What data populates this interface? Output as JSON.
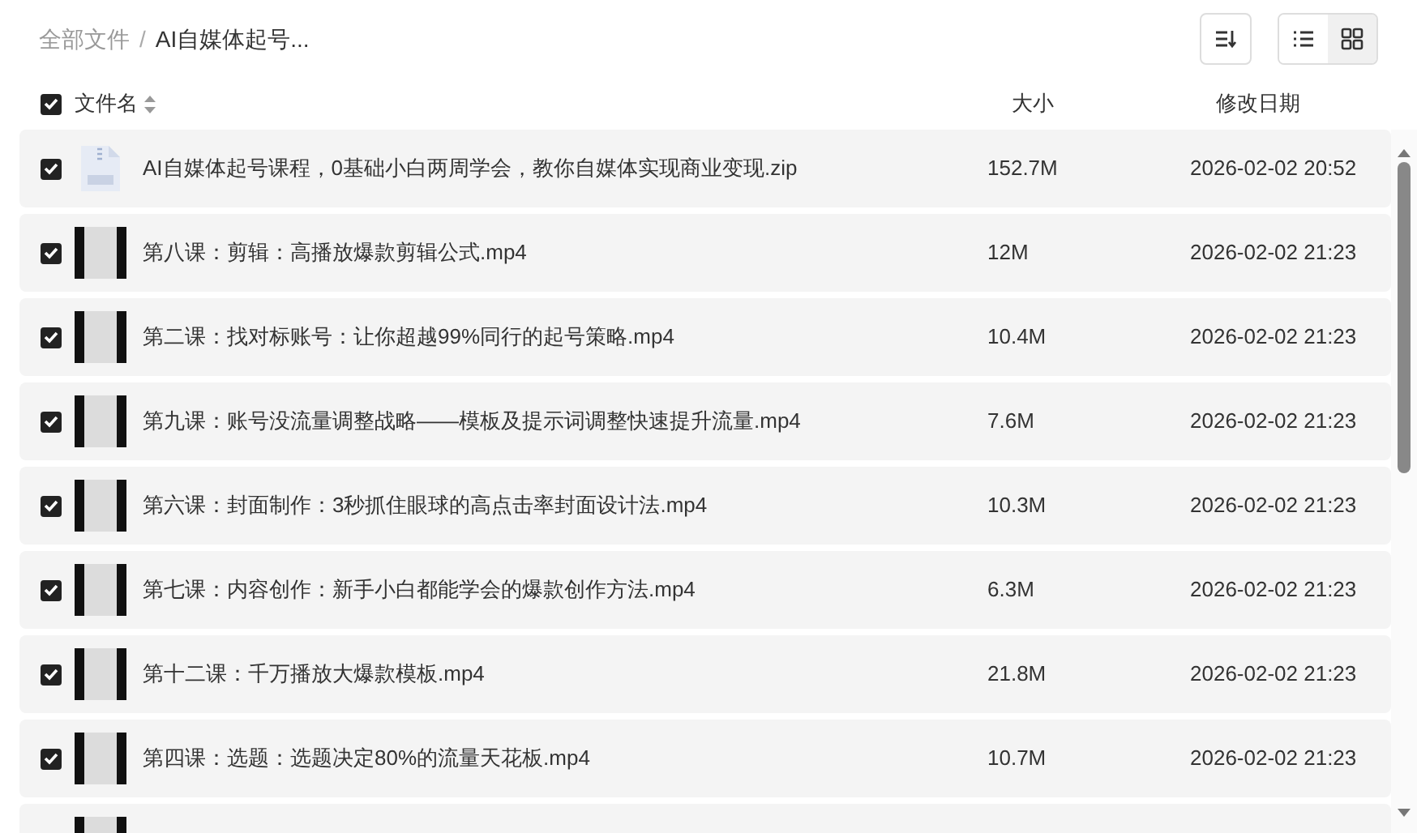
{
  "breadcrumb": [
    {
      "label": "全部文件",
      "current": false
    },
    {
      "label": "AI自媒体起号...",
      "current": true
    }
  ],
  "breadcrumb_separator": "/",
  "toolbar": {
    "views": [
      {
        "kind": "list",
        "selected": true
      },
      {
        "kind": "grid",
        "selected": false
      }
    ]
  },
  "header": {
    "checked": true,
    "columns": [
      "文件名",
      "大小",
      "修改日期"
    ]
  },
  "rows": [
    {
      "kind": "zip",
      "checked": true,
      "name": "AI自媒体起号课程，0基础小白两周学会，教你自媒体实现商业变现.zip",
      "size": "152.7M",
      "date": "2026-02-02 20:52"
    },
    {
      "kind": "video",
      "checked": true,
      "name": "第八课：剪辑：高播放爆款剪辑公式.mp4",
      "size": "12M",
      "date": "2026-02-02 21:23"
    },
    {
      "kind": "video",
      "checked": true,
      "name": "第二课：找对标账号：让你超越99%同行的起号策略.mp4",
      "size": "10.4M",
      "date": "2026-02-02 21:23"
    },
    {
      "kind": "video",
      "checked": true,
      "name": "第九课：账号没流量调整战略——模板及提示词调整快速提升流量.mp4",
      "size": "7.6M",
      "date": "2026-02-02 21:23"
    },
    {
      "kind": "video",
      "checked": true,
      "name": "第六课：封面制作：3秒抓住眼球的高点击率封面设计法.mp4",
      "size": "10.3M",
      "date": "2026-02-02 21:23"
    },
    {
      "kind": "video",
      "checked": true,
      "name": "第七课：内容创作：新手小白都能学会的爆款创作方法.mp4",
      "size": "6.3M",
      "date": "2026-02-02 21:23"
    },
    {
      "kind": "video",
      "checked": true,
      "name": "第十二课：千万播放大爆款模板.mp4",
      "size": "21.8M",
      "date": "2026-02-02 21:23"
    },
    {
      "kind": "video",
      "checked": true,
      "name": "第四课：选题：选题决定80%的流量天花板.mp4",
      "size": "10.7M",
      "date": "2026-02-02 21:23"
    },
    {
      "kind": "video"
    }
  ]
}
